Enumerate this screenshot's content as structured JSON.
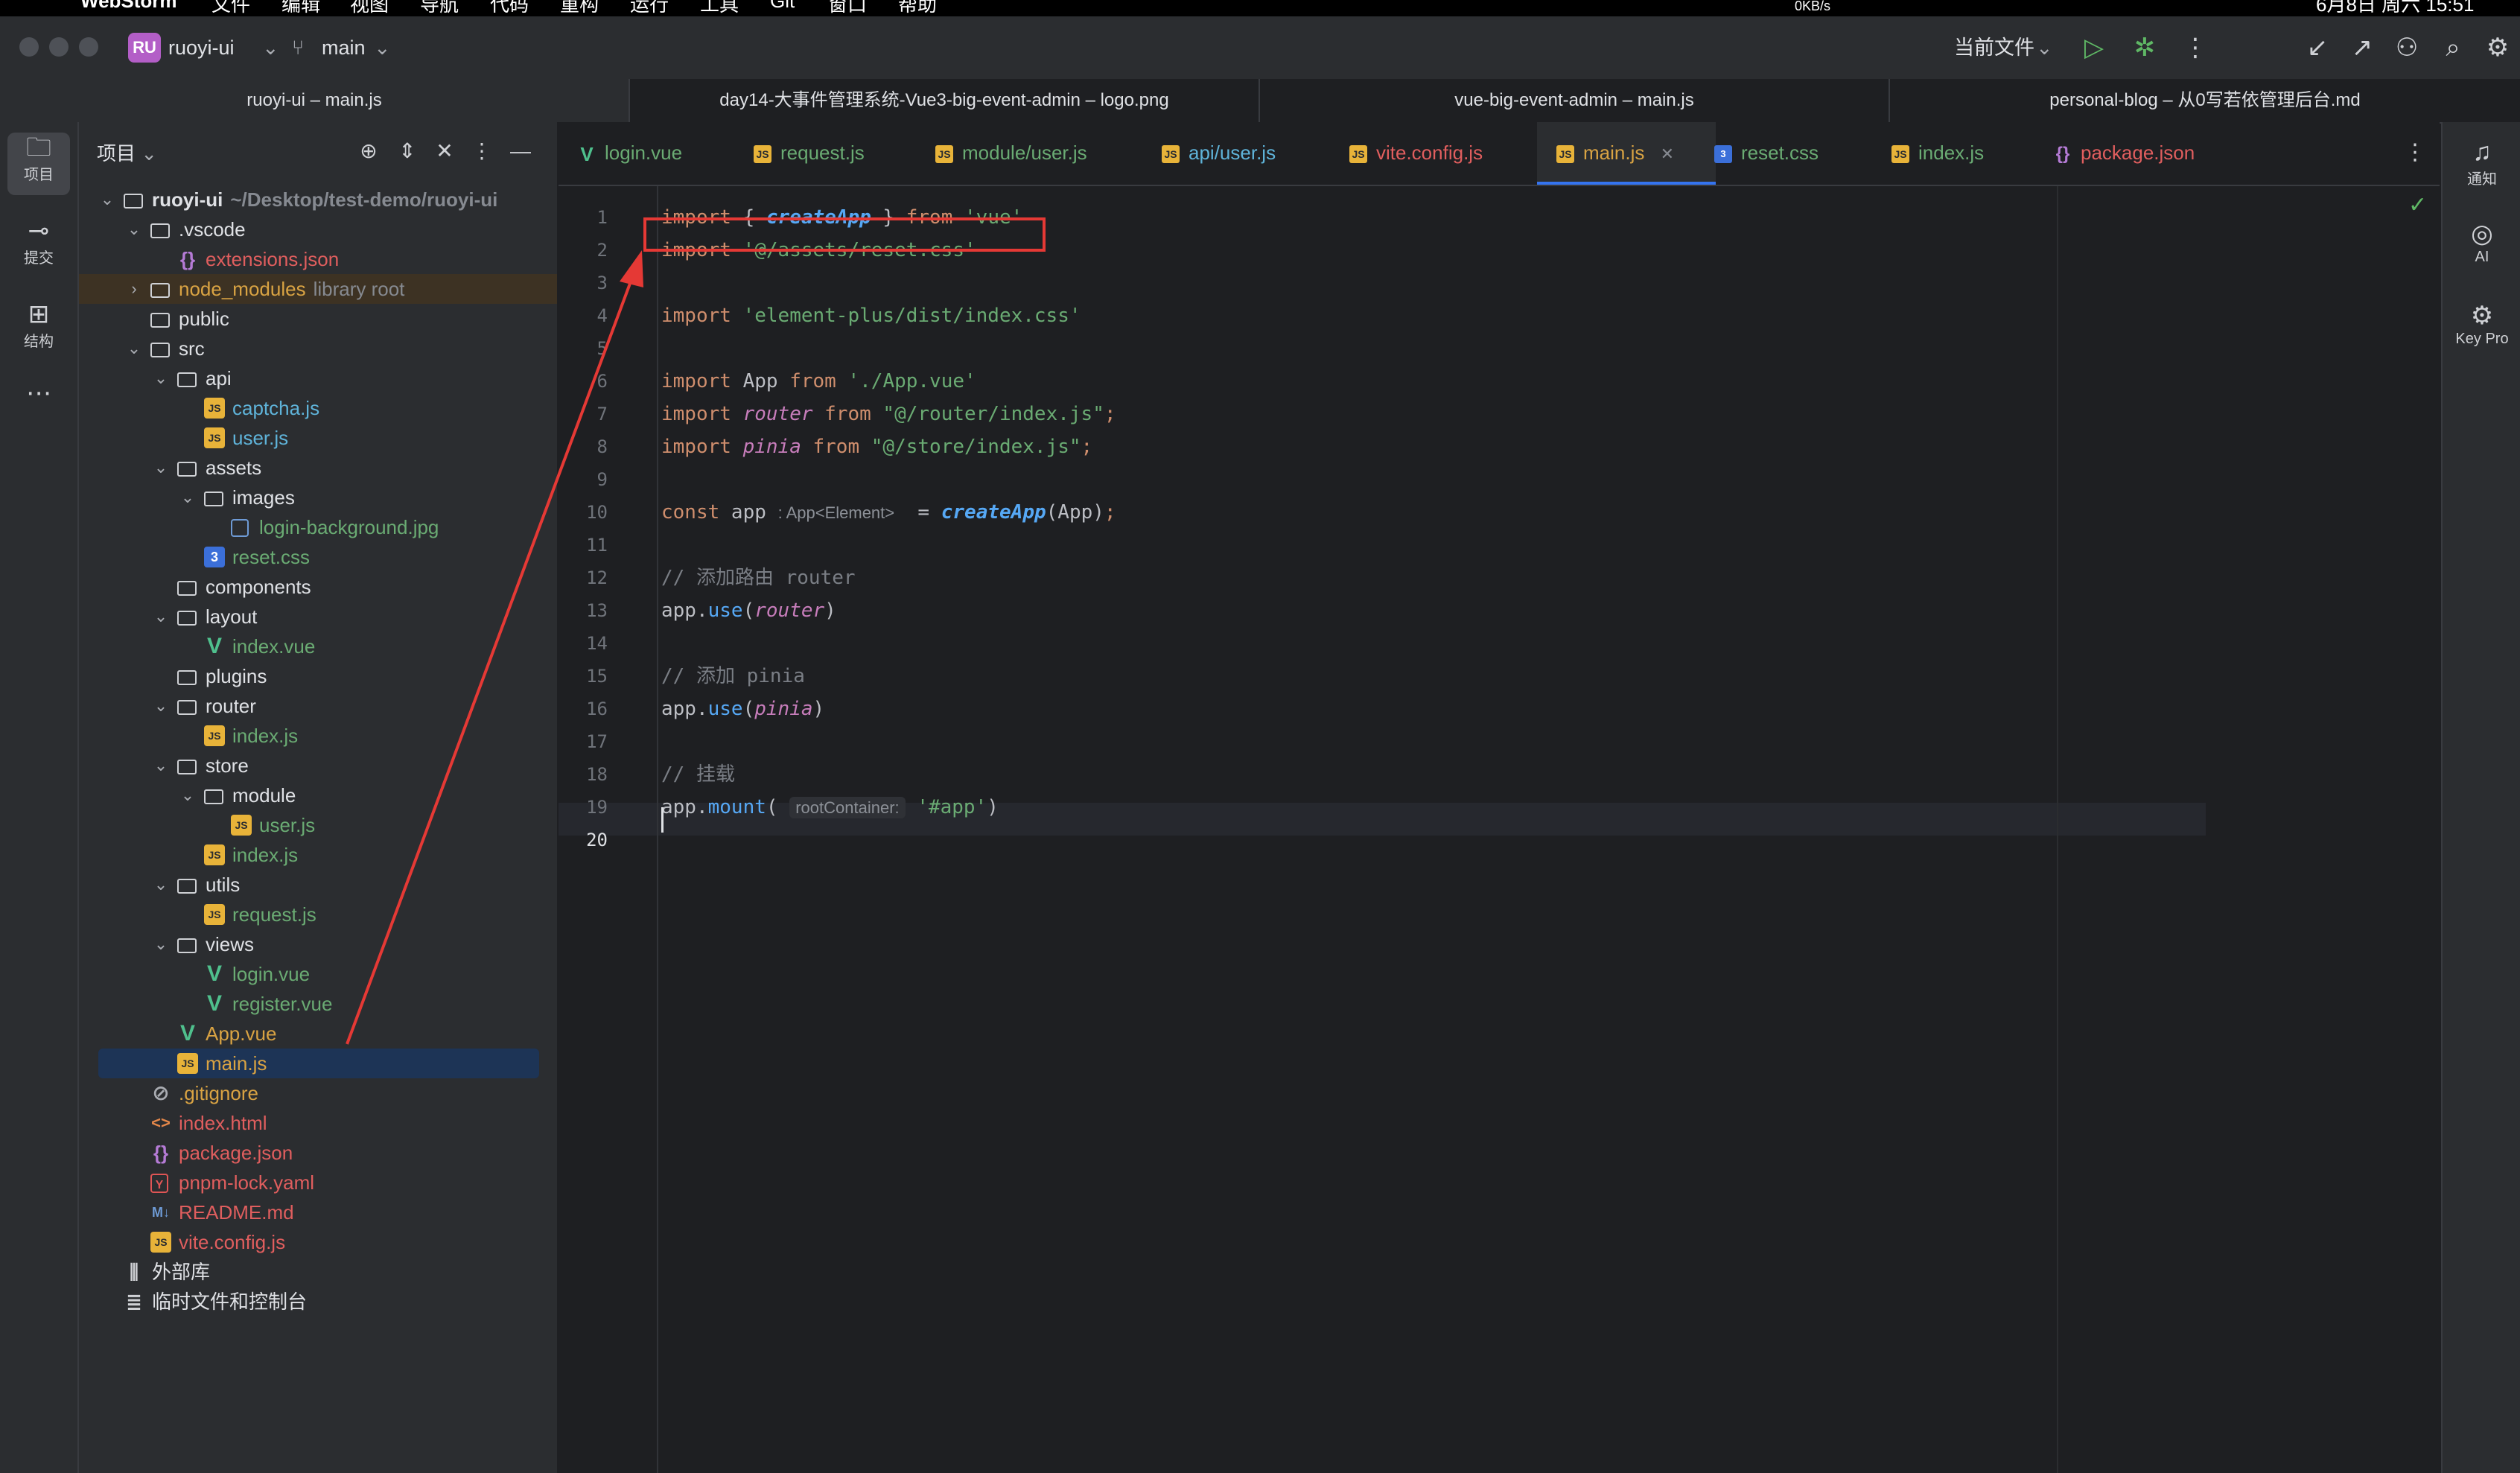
{
  "menubar": {
    "app_name": "WebStorm",
    "items": [
      "文件",
      "编辑",
      "视图",
      "导航",
      "代码",
      "重构",
      "运行",
      "工具",
      "Git",
      "窗口",
      "帮助"
    ],
    "net_speed": "0KB/s",
    "clock": "6月8日 周六 15:51"
  },
  "titlebar": {
    "project_badge": "RU",
    "project_name": "ruoyi-ui",
    "branch": "main",
    "run_config": "当前文件"
  },
  "window_tabs": [
    {
      "label": "ruoyi-ui – main.js",
      "active": true
    },
    {
      "label": "day14-大事件管理系统-Vue3-big-event-admin – logo.png",
      "active": false
    },
    {
      "label": "vue-big-event-admin – main.js",
      "active": false
    },
    {
      "label": "personal-blog – 从0写若依管理后台.md",
      "active": false
    }
  ],
  "left_strip": [
    {
      "icon": "folder-icon",
      "glyph": "🗀",
      "label": "项目",
      "active": true
    },
    {
      "icon": "commit-icon",
      "glyph": "⊸",
      "label": "提交",
      "active": false
    },
    {
      "icon": "structure-icon",
      "glyph": "⊞",
      "label": "结构",
      "active": false
    },
    {
      "icon": "more-icon",
      "glyph": "⋯",
      "label": "",
      "active": false
    }
  ],
  "project_panel": {
    "title": "项目",
    "tree": [
      {
        "depth": 0,
        "chev": "v",
        "icon": "folder",
        "name": "ruoyi-ui",
        "sub": "~/Desktop/test-demo/ruoyi-ui",
        "bold": true
      },
      {
        "depth": 1,
        "chev": "v",
        "icon": "folder",
        "name": ".vscode"
      },
      {
        "depth": 2,
        "chev": "",
        "icon": "json",
        "name": "extensions.json",
        "color": "#e05e5e"
      },
      {
        "depth": 1,
        "chev": ">",
        "icon": "folder",
        "name": "node_modules",
        "sub": "library root",
        "color": "#d9a343",
        "highlight": true
      },
      {
        "depth": 1,
        "chev": "",
        "icon": "folder",
        "name": "public"
      },
      {
        "depth": 1,
        "chev": "v",
        "icon": "folder",
        "name": "src"
      },
      {
        "depth": 2,
        "chev": "v",
        "icon": "folder",
        "name": "api"
      },
      {
        "depth": 3,
        "chev": "",
        "icon": "js",
        "name": "captcha.js",
        "color": "#5fb3d9"
      },
      {
        "depth": 3,
        "chev": "",
        "icon": "js",
        "name": "user.js",
        "color": "#5fb3d9"
      },
      {
        "depth": 2,
        "chev": "v",
        "icon": "folder",
        "name": "assets"
      },
      {
        "depth": 3,
        "chev": "v",
        "icon": "folder",
        "name": "images"
      },
      {
        "depth": 4,
        "chev": "",
        "icon": "img",
        "name": "login-background.jpg",
        "color": "#6aab73"
      },
      {
        "depth": 3,
        "chev": "",
        "icon": "css",
        "name": "reset.css",
        "color": "#6aab73"
      },
      {
        "depth": 2,
        "chev": "",
        "icon": "folder",
        "name": "components"
      },
      {
        "depth": 2,
        "chev": "v",
        "icon": "folder",
        "name": "layout"
      },
      {
        "depth": 3,
        "chev": "",
        "icon": "vue",
        "name": "index.vue",
        "color": "#6aab73"
      },
      {
        "depth": 2,
        "chev": "",
        "icon": "folder",
        "name": "plugins"
      },
      {
        "depth": 2,
        "chev": "v",
        "icon": "folder",
        "name": "router"
      },
      {
        "depth": 3,
        "chev": "",
        "icon": "js",
        "name": "index.js",
        "color": "#6aab73"
      },
      {
        "depth": 2,
        "chev": "v",
        "icon": "folder",
        "name": "store"
      },
      {
        "depth": 3,
        "chev": "v",
        "icon": "folder",
        "name": "module"
      },
      {
        "depth": 4,
        "chev": "",
        "icon": "js",
        "name": "user.js",
        "color": "#6aab73"
      },
      {
        "depth": 3,
        "chev": "",
        "icon": "js",
        "name": "index.js",
        "color": "#6aab73"
      },
      {
        "depth": 2,
        "chev": "v",
        "icon": "folder",
        "name": "utils"
      },
      {
        "depth": 3,
        "chev": "",
        "icon": "js",
        "name": "request.js",
        "color": "#6aab73"
      },
      {
        "depth": 2,
        "chev": "v",
        "icon": "folder",
        "name": "views"
      },
      {
        "depth": 3,
        "chev": "",
        "icon": "vue",
        "name": "login.vue",
        "color": "#6aab73"
      },
      {
        "depth": 3,
        "chev": "",
        "icon": "vue",
        "name": "register.vue",
        "color": "#6aab73"
      },
      {
        "depth": 2,
        "chev": "",
        "icon": "vue",
        "name": "App.vue",
        "color": "#d9a343"
      },
      {
        "depth": 2,
        "chev": "",
        "icon": "js",
        "name": "main.js",
        "color": "#d9a343",
        "selected": true
      },
      {
        "depth": 1,
        "chev": "",
        "icon": "git",
        "name": ".gitignore",
        "color": "#d9a343"
      },
      {
        "depth": 1,
        "chev": "",
        "icon": "html",
        "name": "index.html",
        "color": "#e05e5e"
      },
      {
        "depth": 1,
        "chev": "",
        "icon": "json",
        "name": "package.json",
        "color": "#e05e5e"
      },
      {
        "depth": 1,
        "chev": "",
        "icon": "yaml",
        "name": "pnpm-lock.yaml",
        "color": "#e05e5e"
      },
      {
        "depth": 1,
        "chev": "",
        "icon": "md",
        "name": "README.md",
        "color": "#e05e5e"
      },
      {
        "depth": 1,
        "chev": "",
        "icon": "js",
        "name": "vite.config.js",
        "color": "#e05e5e"
      },
      {
        "depth": 0,
        "chev": "",
        "icon": "lib",
        "name": "外部库"
      },
      {
        "depth": 0,
        "chev": "",
        "icon": "scratch",
        "name": "临时文件和控制台"
      }
    ]
  },
  "editor_tabs": [
    {
      "label": "login.vue",
      "icon": "vue",
      "color": "#6aab73"
    },
    {
      "label": "request.js",
      "icon": "js",
      "color": "#6aab73"
    },
    {
      "label": "module/user.js",
      "icon": "js",
      "color": "#6aab73"
    },
    {
      "label": "api/user.js",
      "icon": "js",
      "color": "#5fb3d9"
    },
    {
      "label": "vite.config.js",
      "icon": "js",
      "color": "#e05e5e"
    },
    {
      "label": "main.js",
      "icon": "js",
      "color": "#d9a343",
      "active": true
    },
    {
      "label": "reset.css",
      "icon": "css",
      "color": "#6aab73"
    },
    {
      "label": "index.js",
      "icon": "js",
      "color": "#6aab73"
    },
    {
      "label": "package.json",
      "icon": "json",
      "color": "#e05e5e"
    }
  ],
  "editor": {
    "line_numbers": [
      "1",
      "2",
      "3",
      "4",
      "5",
      "6",
      "7",
      "8",
      "9",
      "10",
      "11",
      "12",
      "13",
      "14",
      "15",
      "16",
      "17",
      "18",
      "19",
      "20"
    ],
    "current_line": 20,
    "code": {
      "l1_kw": "import",
      "l1_a": " { ",
      "l1_fn": "createApp",
      "l1_b": " } ",
      "l1_from": "from",
      "l1_str": " 'vue'",
      "l2_kw": "import",
      "l2_str": " '@/assets/reset.css'",
      "l4_kw": "import",
      "l4_str": " 'element-plus/dist/index.css'",
      "l6_kw": "import",
      "l6_a": " App ",
      "l6_from": "from",
      "l6_str": " './App.vue'",
      "l7_kw": "import",
      "l7_pv": " router",
      "l7_from": " from",
      "l7_str": " \"@/router/index.js\"",
      "l7_semi": ";",
      "l8_kw": "import",
      "l8_pv": " pinia",
      "l8_from": " from",
      "l8_str": " \"@/store/index.js\"",
      "l8_semi": ";",
      "l10_kw": "const",
      "l10_a": " app ",
      "l10_hint": ": App<Element>",
      "l10_eq": "  = ",
      "l10_fn": "createApp",
      "l10_b": "(App)",
      "l10_semi": ";",
      "l12_cm": "// 添加路由 router",
      "l13_a": "app.",
      "l13_fn": "use",
      "l13_b": "(",
      "l13_pv": "router",
      "l13_c": ")",
      "l15_cm": "// 添加 pinia",
      "l16_a": "app.",
      "l16_fn": "use",
      "l16_b": "(",
      "l16_pv": "pinia",
      "l16_c": ")",
      "l18_cm": "// 挂载",
      "l19_a": "app.",
      "l19_fn": "mount",
      "l19_b": "( ",
      "l19_hint": "rootContainer:",
      "l19_str": " '#app'",
      "l19_c": ")"
    }
  },
  "right_strip": [
    {
      "icon": "bell-icon",
      "glyph": "🔔",
      "label": "通知"
    },
    {
      "icon": "ai-icon",
      "glyph": "◎",
      "label": "AI"
    },
    {
      "icon": "key-promoter-icon",
      "glyph": "⚙",
      "label": "Key Pro"
    }
  ],
  "colors": {
    "annotation": "#e53935",
    "accent": "#3574f0"
  }
}
